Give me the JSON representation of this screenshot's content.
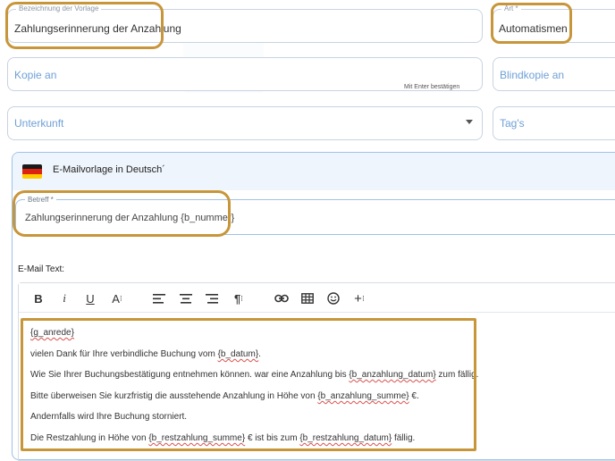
{
  "template_name": {
    "label": "Bezeichnung der Vorlage",
    "value": "Zahlungserinnerung der Anzahlung"
  },
  "type": {
    "label": "Art *",
    "value": "Automatismen"
  },
  "cc": {
    "placeholder": "Kopie an",
    "hint": "Mit Enter bestätigen"
  },
  "bcc": {
    "placeholder": "Blindkopie an"
  },
  "accommodation": {
    "placeholder": "Unterkunft"
  },
  "tags": {
    "placeholder": "Tag's"
  },
  "email_template": {
    "header": "E-Mailvorlage in Deutsch´",
    "subject": {
      "label": "Betreff *",
      "value": "Zahlungserinnerung der Anzahlung {b_nummer}"
    },
    "body_label": "E-Mail Text:",
    "toolbar": [
      "B",
      "I",
      "U",
      "A",
      "align-left",
      "align-center",
      "align-right",
      "paragraph",
      "link",
      "table",
      "emoji",
      "insert"
    ],
    "body": {
      "l1": "{g_anrede}",
      "l2a": "vielen Dank für Ihre verbindliche Buchung vom ",
      "l2b": "{b_datum}",
      "l2c": ".",
      "l3a": "Wie Sie Ihrer Buchungsbestätigung entnehmen können. war eine Anzahlung bis ",
      "l3b": "{b_anzahlung_datum}",
      "l3c": " zum fällig.",
      "l4a": "Bitte überweisen Sie kurzfristig die ausstehende Anzahlung in Höhe von ",
      "l4b": "{b_anzahlung_summe}",
      "l4c": " €.",
      "l5": "Andernfalls wird Ihre Buchung storniert.",
      "l6a": "Die Restzahlung in Höhe von ",
      "l6b": "{b_restzahlung_summe}",
      "l6c": " € ist bis zum ",
      "l6d": "{b_restzahlung_datum}",
      "l6e": " fällig."
    }
  },
  "colors": {
    "highlight": "#c8963a",
    "field_border": "#c9d3e1",
    "placeholder": "#6fa0d6",
    "panel_bg": "#eef5fc"
  }
}
